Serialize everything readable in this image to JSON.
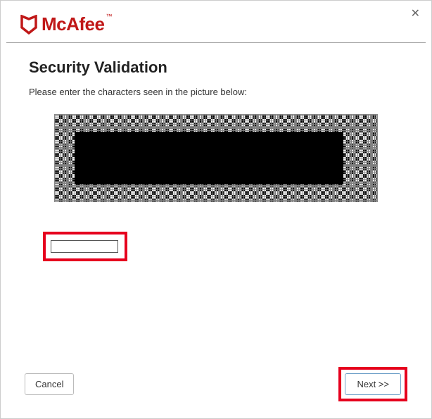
{
  "window": {
    "close_symbol": "✕"
  },
  "brand": {
    "name": "McAfee",
    "tm": "™"
  },
  "page": {
    "title": "Security Validation",
    "instruction": "Please enter the characters seen in the picture below:"
  },
  "form": {
    "captcha_value": ""
  },
  "buttons": {
    "cancel": "Cancel",
    "next": "Next >>"
  }
}
